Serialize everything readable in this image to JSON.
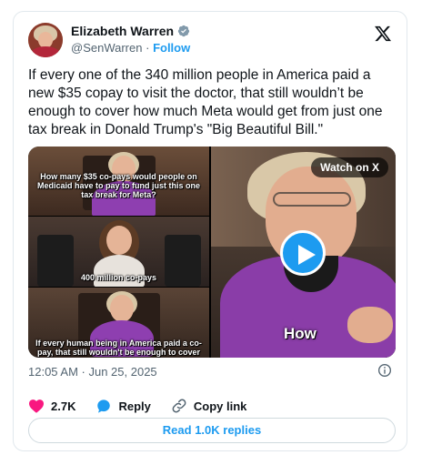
{
  "author": {
    "name": "Elizabeth Warren",
    "handle": "@SenWarren",
    "separator": "·",
    "follow_label": "Follow"
  },
  "tweet": {
    "text": "If every one of the 340 million people in America paid a new $35 copay to visit the doctor, that still wouldn’t be enough to cover how much Meta would get from just one tax break in Donald Trump's \"Big Beautiful Bill.\"",
    "timestamp": "12:05 AM · Jun 25, 2025"
  },
  "media": {
    "left_captions": [
      "How many $35 co-pays would people on Medicaid have to pay to fund just this one tax break for Meta?",
      "400 million co-pays",
      "If every human being in America paid a co-pay, that still wouldn't be enough to cover what"
    ],
    "watch_label": "Watch on X",
    "video_caption": "How"
  },
  "actions": {
    "likes": "2.7K",
    "reply_label": "Reply",
    "copy_label": "Copy link"
  },
  "read_replies": "Read 1.0K replies",
  "colors": {
    "accent": "#1d9bf0",
    "like": "#f91880",
    "text": "#0f1419",
    "muted": "#536471"
  },
  "icons": [
    "verified-badge-icon",
    "x-logo-icon",
    "play-icon",
    "info-icon",
    "heart-icon",
    "reply-bubble-icon",
    "link-icon"
  ]
}
